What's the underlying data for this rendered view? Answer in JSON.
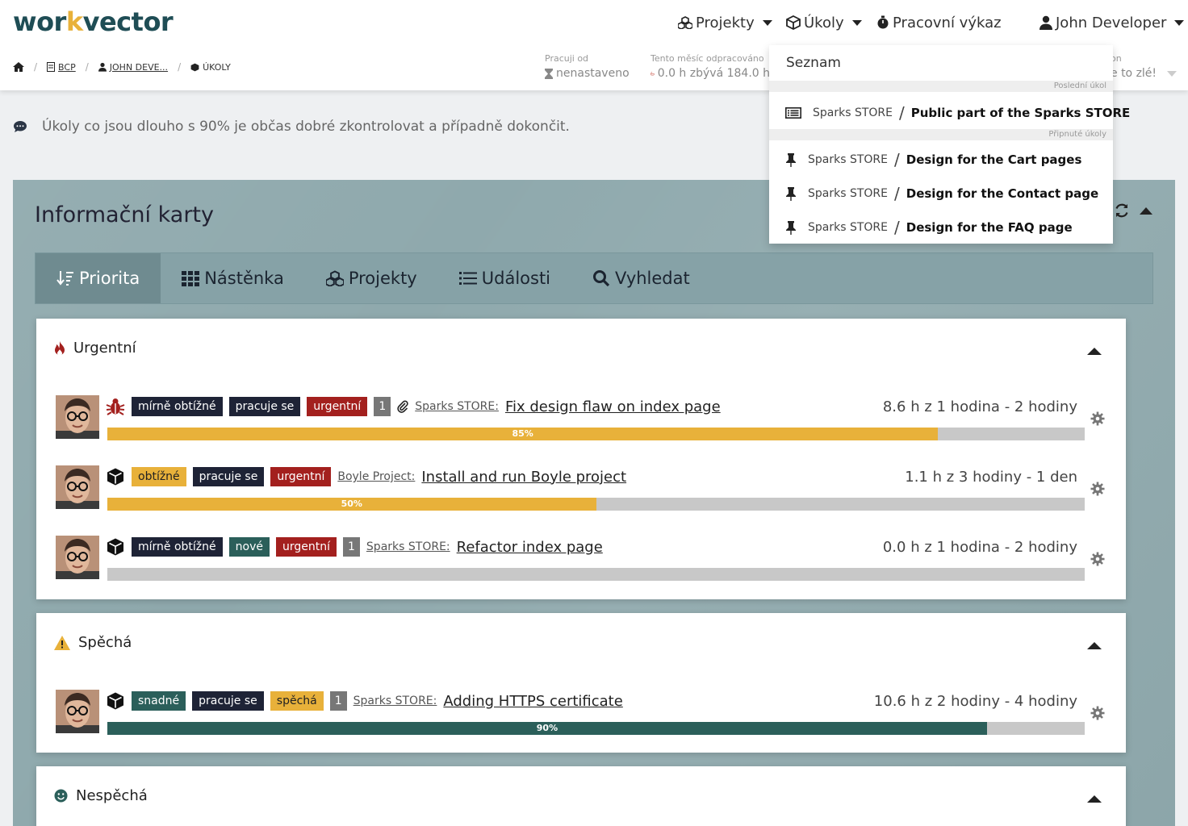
{
  "app": {
    "logo": {
      "pre": "wor",
      "o": "k",
      "post": "vector"
    }
  },
  "nav": {
    "projekty": "Projekty",
    "ukoly": "Úkoly",
    "vykaz": "Pracovní výkaz",
    "user": "John Developer"
  },
  "breadcrumb": {
    "items": [
      "BCP",
      "JOHN DEVE...",
      "ÚKOLY"
    ]
  },
  "stats": {
    "pracuji_label": "Pracuji od",
    "pracuji_value": "nenastaveno",
    "mesic_label": "Tento měsíc odpracováno",
    "mesic_value": "0.0 h zbývá 184.0 h",
    "third_label": "on",
    "third_value": "e to zlé!"
  },
  "info": {
    "message": "Úkoly co jsou dlouho s 90% je občas dobré zkontrolovat a případně dokončit."
  },
  "panel": {
    "title": "Informační karty",
    "tabs": [
      "Priorita",
      "Nástěnka",
      "Projekty",
      "Události",
      "Vyhledat"
    ]
  },
  "cards": [
    {
      "title": "Urgentní",
      "tasks": [
        {
          "icon": "bug-icon",
          "badges": [
            {
              "text": "mírně obtížné",
              "style": "dark"
            },
            {
              "text": "pracuje se",
              "style": "dark"
            },
            {
              "text": "urgentní",
              "style": "red"
            },
            {
              "text": "1",
              "style": "gray"
            }
          ],
          "attachment": true,
          "project": "Sparks STORE:",
          "name": "Fix design flaw on index page",
          "hours": "8.6 h z 1 hodina - 2 hodiny",
          "progress": 85,
          "progress_label": "85%",
          "color": "yellow"
        },
        {
          "icon": "cube-icon",
          "badges": [
            {
              "text": "obtížné",
              "style": "yellow"
            },
            {
              "text": "pracuje se",
              "style": "dark"
            },
            {
              "text": "urgentní",
              "style": "red"
            }
          ],
          "attachment": false,
          "project": "Boyle Project:",
          "name": "Install and run Boyle project",
          "hours": "1.1 h z 3 hodiny - 1 den",
          "progress": 50,
          "progress_label": "50%",
          "color": "yellow"
        },
        {
          "icon": "cube-icon",
          "badges": [
            {
              "text": "mírně obtížné",
              "style": "dark"
            },
            {
              "text": "nové",
              "style": "teal"
            },
            {
              "text": "urgentní",
              "style": "red"
            },
            {
              "text": "1",
              "style": "gray"
            }
          ],
          "attachment": false,
          "project": "Sparks STORE:",
          "name": "Refactor index page",
          "hours": "0.0 h z 1 hodina - 2 hodiny",
          "progress": 0,
          "progress_label": "",
          "color": "yellow"
        }
      ]
    },
    {
      "title": "Spěchá",
      "tasks": [
        {
          "icon": "cube-icon",
          "badges": [
            {
              "text": "snadné",
              "style": "teal"
            },
            {
              "text": "pracuje se",
              "style": "dark"
            },
            {
              "text": "spěchá",
              "style": "yellow"
            },
            {
              "text": "1",
              "style": "gray"
            }
          ],
          "attachment": false,
          "project": "Sparks STORE:",
          "name": "Adding HTTPS certificate",
          "hours": "10.6 h z 2 hodiny - 4 hodiny",
          "progress": 90,
          "progress_label": "90%",
          "color": "teal"
        }
      ]
    },
    {
      "title": "Nespěchá",
      "tasks": []
    }
  ],
  "dropdown": {
    "header": "Seznam",
    "recent_label": "Poslední úkol",
    "recent": {
      "project": "Sparks STORE",
      "name": "Public part of the Sparks STORE"
    },
    "pinned_label": "Připnuté úkoly",
    "pinned": [
      {
        "project": "Sparks STORE",
        "name": "Design for the Cart pages"
      },
      {
        "project": "Sparks STORE",
        "name": "Design for the Contact page"
      },
      {
        "project": "Sparks STORE",
        "name": "Design for the FAQ page"
      }
    ]
  },
  "colors": {
    "accent_teal": "#2b5f5a",
    "accent_yellow": "#e8b13a",
    "urgent_red": "#a3201e",
    "panel_bg": "#8fa9ad"
  }
}
